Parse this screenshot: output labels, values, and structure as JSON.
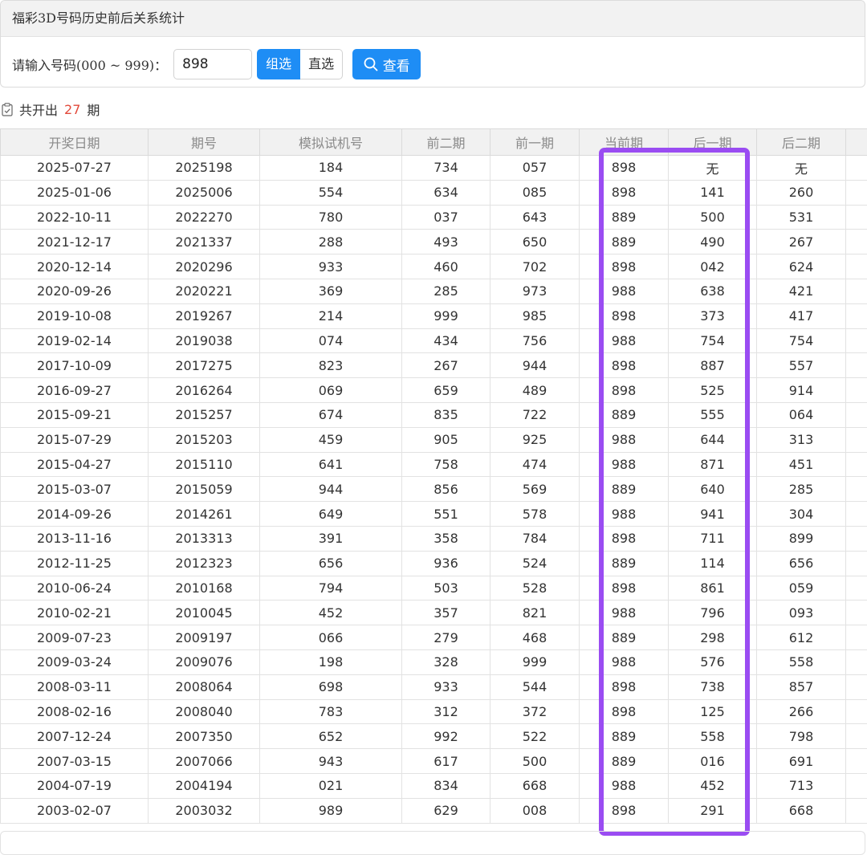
{
  "panel": {
    "title": "福彩3D号码历史前后关系统计"
  },
  "form": {
    "label": "请输入号码(000 ~ 999)：",
    "input_value": "898",
    "group_label": "组选",
    "direct_label": "直选",
    "search_label": "查看"
  },
  "summary": {
    "prefix": "共开出",
    "count": "27",
    "suffix": "期"
  },
  "colors": {
    "accent": "#1e8df5",
    "count": "#e24a3b",
    "highlight": "#9a4cf2"
  },
  "table": {
    "columns": [
      "开奖日期",
      "期号",
      "模拟试机号",
      "前二期",
      "前一期",
      "当前期",
      "后一期",
      "后二期",
      ""
    ],
    "rows": [
      [
        "2025-07-27",
        "2025198",
        "184",
        "734",
        "057",
        "898",
        "无",
        "无",
        ""
      ],
      [
        "2025-01-06",
        "2025006",
        "554",
        "634",
        "085",
        "898",
        "141",
        "260",
        ""
      ],
      [
        "2022-10-11",
        "2022270",
        "780",
        "037",
        "643",
        "889",
        "500",
        "531",
        ""
      ],
      [
        "2021-12-17",
        "2021337",
        "288",
        "493",
        "650",
        "889",
        "490",
        "267",
        ""
      ],
      [
        "2020-12-14",
        "2020296",
        "933",
        "460",
        "702",
        "898",
        "042",
        "624",
        ""
      ],
      [
        "2020-09-26",
        "2020221",
        "369",
        "285",
        "973",
        "988",
        "638",
        "421",
        ""
      ],
      [
        "2019-10-08",
        "2019267",
        "214",
        "999",
        "985",
        "898",
        "373",
        "417",
        ""
      ],
      [
        "2019-02-14",
        "2019038",
        "074",
        "434",
        "756",
        "988",
        "754",
        "754",
        ""
      ],
      [
        "2017-10-09",
        "2017275",
        "823",
        "267",
        "944",
        "898",
        "887",
        "557",
        ""
      ],
      [
        "2016-09-27",
        "2016264",
        "069",
        "659",
        "489",
        "898",
        "525",
        "914",
        ""
      ],
      [
        "2015-09-21",
        "2015257",
        "674",
        "835",
        "722",
        "889",
        "555",
        "064",
        ""
      ],
      [
        "2015-07-29",
        "2015203",
        "459",
        "905",
        "925",
        "988",
        "644",
        "313",
        ""
      ],
      [
        "2015-04-27",
        "2015110",
        "641",
        "758",
        "474",
        "988",
        "871",
        "451",
        ""
      ],
      [
        "2015-03-07",
        "2015059",
        "944",
        "856",
        "569",
        "889",
        "640",
        "285",
        ""
      ],
      [
        "2014-09-26",
        "2014261",
        "649",
        "551",
        "578",
        "988",
        "941",
        "304",
        ""
      ],
      [
        "2013-11-16",
        "2013313",
        "391",
        "358",
        "784",
        "898",
        "711",
        "899",
        ""
      ],
      [
        "2012-11-25",
        "2012323",
        "656",
        "936",
        "524",
        "889",
        "114",
        "656",
        ""
      ],
      [
        "2010-06-24",
        "2010168",
        "794",
        "503",
        "528",
        "898",
        "861",
        "059",
        ""
      ],
      [
        "2010-02-21",
        "2010045",
        "452",
        "357",
        "821",
        "988",
        "796",
        "093",
        ""
      ],
      [
        "2009-07-23",
        "2009197",
        "066",
        "279",
        "468",
        "889",
        "298",
        "612",
        ""
      ],
      [
        "2009-03-24",
        "2009076",
        "198",
        "328",
        "999",
        "988",
        "576",
        "558",
        ""
      ],
      [
        "2008-03-11",
        "2008064",
        "698",
        "933",
        "544",
        "898",
        "738",
        "857",
        ""
      ],
      [
        "2008-02-16",
        "2008040",
        "783",
        "312",
        "372",
        "898",
        "125",
        "266",
        ""
      ],
      [
        "2007-12-24",
        "2007350",
        "652",
        "992",
        "522",
        "889",
        "558",
        "798",
        ""
      ],
      [
        "2007-03-15",
        "2007066",
        "943",
        "617",
        "500",
        "889",
        "016",
        "691",
        ""
      ],
      [
        "2004-07-19",
        "2004194",
        "021",
        "834",
        "668",
        "988",
        "452",
        "713",
        ""
      ],
      [
        "2003-02-07",
        "2003032",
        "989",
        "629",
        "008",
        "898",
        "291",
        "668",
        ""
      ]
    ]
  }
}
